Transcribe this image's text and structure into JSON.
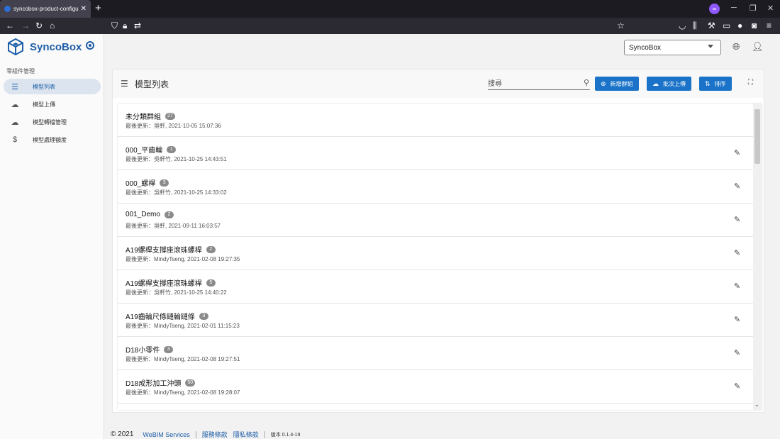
{
  "browser": {
    "tab_title": "syncobox-product-configurator",
    "new_tab": "+",
    "extension_label": "∞"
  },
  "brand": {
    "name": "SyncoBox"
  },
  "sidebar": {
    "section": "零組件管理",
    "items": [
      {
        "label": "模型列表",
        "icon": "list-icon",
        "active": true
      },
      {
        "label": "模型上傳",
        "icon": "cloud-upload-icon",
        "active": false
      },
      {
        "label": "模型轉檔管理",
        "icon": "cloud-sync-icon",
        "active": false
      },
      {
        "label": "模型處理額度",
        "icon": "dollar-icon",
        "active": false
      }
    ]
  },
  "header": {
    "tenant": "SyncoBox"
  },
  "panel": {
    "title": "模型列表",
    "search_placeholder": "搜尋",
    "buttons": {
      "new_group": "新增群組",
      "batch_upload": "批次上傳",
      "sort": "排序"
    }
  },
  "groups": [
    {
      "name": "未分類群組",
      "count": "27",
      "updated": "最後更新：吳軒, 2021-10-05 15:07:36",
      "editable": false
    },
    {
      "name": "000_平齒輪",
      "count": "1",
      "updated": "最後更新：吳軒竹, 2021-10-25 14:43:51",
      "editable": true
    },
    {
      "name": "000_螺桿",
      "count": "3",
      "updated": "最後更新：吳軒竹, 2021-10-25 14:33:02",
      "editable": true
    },
    {
      "name": "001_Demo",
      "count": "2",
      "updated": "最後更新：吳軒, 2021-09-11 16:03:57",
      "editable": true
    },
    {
      "name": "A19螺桿支撐座滾珠螺桿",
      "count": "2",
      "updated": "最後更新：MindyTseng, 2021-02-08 19:27:35",
      "editable": true
    },
    {
      "name": "A19螺桿支撐座滾珠螺桿",
      "count": "5",
      "updated": "最後更新：吳軒竹, 2021-10-25 14:40:22",
      "editable": true
    },
    {
      "name": "A19齒輪尺條鏈輪鏈條",
      "count": "3",
      "updated": "最後更新：MindyTseng, 2021-02-01 11:15:23",
      "editable": true
    },
    {
      "name": "D18小零件",
      "count": "3",
      "updated": "最後更新：MindyTseng, 2021-02-08 19:27:51",
      "editable": true
    },
    {
      "name": "D18成形加工沖頭",
      "count": "50",
      "updated": "最後更新：MindyTseng, 2021-02-08 19:28:07",
      "editable": true
    }
  ],
  "footer": {
    "copyright": "© 2021",
    "company": "WeBIM Services",
    "terms": "服務條款",
    "privacy": "隱私條款",
    "version": "版本 0.1.4-19"
  }
}
